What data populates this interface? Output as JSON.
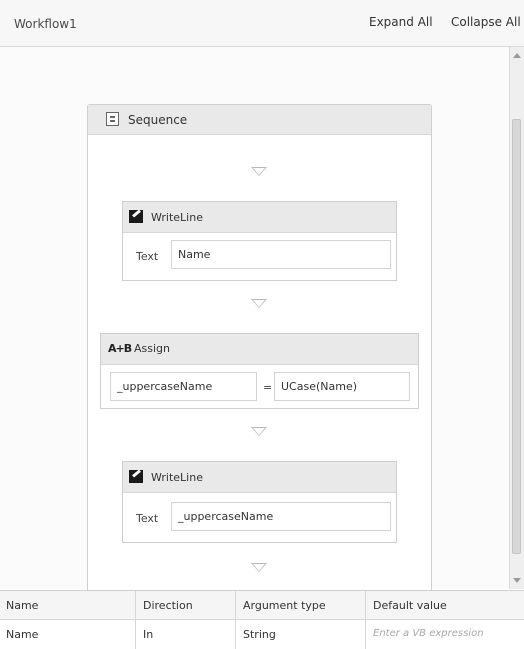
{
  "header": {
    "title": "Workflow1",
    "expand_all": "Expand All",
    "collapse_all": "Collapse All"
  },
  "sequence": {
    "label": "Sequence",
    "writeline1": {
      "label": "WriteLine",
      "text_label": "Text",
      "text_value": "Name"
    },
    "assign": {
      "label": "Assign",
      "icon_text": "A+B",
      "to_value": "_uppercaseName",
      "equals": "=",
      "value": "UCase(Name)"
    },
    "writeline2": {
      "label": "WriteLine",
      "text_label": "Text",
      "text_value": "_uppercaseName"
    }
  },
  "arguments": {
    "columns": [
      "Name",
      "Direction",
      "Argument type",
      "Default value"
    ],
    "rows": [
      {
        "name": "Name",
        "direction": "In",
        "type": "String",
        "default_placeholder": "Enter a VB expression"
      }
    ]
  }
}
